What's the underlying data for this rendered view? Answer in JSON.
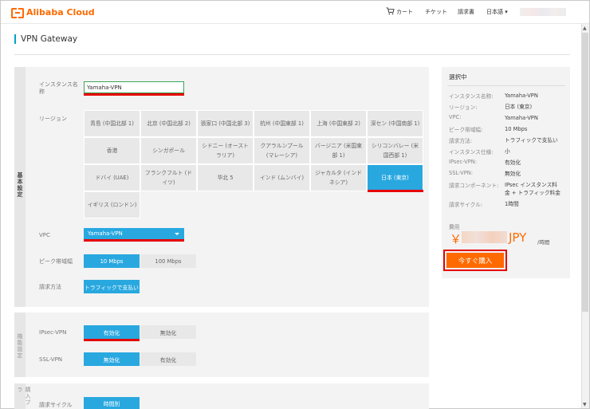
{
  "header": {
    "logo_text": "Alibaba Cloud",
    "nav": {
      "cart": "カート",
      "ticket": "チケット",
      "invoice": "請求書",
      "language": "日本語 ▾"
    }
  },
  "page": {
    "title": "VPN Gateway"
  },
  "sections": {
    "basic": "基本設定",
    "network": "機能設定",
    "purchase": "購入プラ"
  },
  "form": {
    "instance_name": {
      "label": "インスタンス名称",
      "value": "Yamaha-VPN"
    },
    "region": {
      "label": "リージョン",
      "rows": [
        [
          "青島 (中国北部 1)",
          "北京 (中国北部 2)",
          "張家口 (中国北部 3)",
          "杭州 (中国東部 1)",
          "上海 (中国東部 2)",
          "深セン (中国南部 1)"
        ],
        [
          "香港",
          "シンガポール",
          "シドニー (オーストラリア)",
          "クアラルンプール (マレーシア)",
          "バージニア (米国東部 1)",
          "シリコンバレー (米国西部 1)"
        ],
        [
          "ドバイ (UAE)",
          "フランクフルト (ドイツ)",
          "华北 5",
          "インド (ムンバイ)",
          "ジャカルタ (インドネシア)",
          "日本 (東京)"
        ],
        [
          "イギリス (ロンドン)"
        ]
      ],
      "selected": "日本 (東京)"
    },
    "vpc": {
      "label": "VPC",
      "value": "Yamaha-VPN"
    },
    "bandwidth": {
      "label": "ピーク帯域幅",
      "options": [
        "10 Mbps",
        "100 Mbps"
      ],
      "selected": "10 Mbps"
    },
    "billing": {
      "label": "請求方法",
      "value": "トラフィックで支払い"
    },
    "ipsec": {
      "label": "IPsec-VPN",
      "options": [
        "有効化",
        "無効化"
      ],
      "selected": "有効化"
    },
    "ssl": {
      "label": "SSL-VPN",
      "options": [
        "無効化",
        "有効化"
      ],
      "selected": "無効化"
    },
    "cycle": {
      "label": "請求サイクル",
      "value": "時間別"
    }
  },
  "summary": {
    "title": "選択中",
    "rows": [
      {
        "key": "インスタンス名称:",
        "value": "Yamaha-VPN"
      },
      {
        "key": "リージョン:",
        "value": "日本 (東京)"
      },
      {
        "key": "VPC:",
        "value": "Yamaha-VPN"
      },
      {
        "key": "ピーク帯域幅:",
        "value": "10 Mbps"
      },
      {
        "key": "請求方法:",
        "value": "トラフィックで支払い"
      },
      {
        "key": "インスタンス仕様:",
        "value": "小"
      },
      {
        "key": "IPsec-VPN:",
        "value": "有効化"
      },
      {
        "key": "SSL-VPN:",
        "value": "無効化"
      },
      {
        "key": "請求コンポーネント:",
        "value": "IPsec インスタンス料金 + トラフィック料金"
      },
      {
        "key": "請求サイクル:",
        "value": "1時間"
      }
    ],
    "fee_label": "費用",
    "currency": "￥",
    "unit": "JPY",
    "per": "/時間",
    "buy_label": "今すぐ購入"
  },
  "colors": {
    "accent": "#29a8e0",
    "brand": "#ff6a00",
    "highlight": "#e60000"
  }
}
